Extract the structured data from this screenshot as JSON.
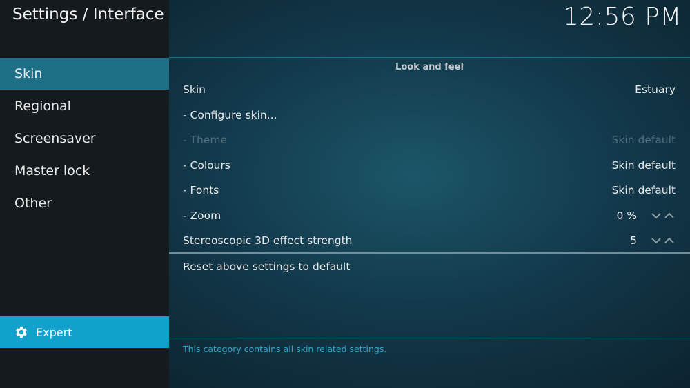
{
  "header": {
    "title": "Settings / Interface",
    "clock": "12:56 PM"
  },
  "sidebar": {
    "items": [
      {
        "label": "Skin",
        "active": true
      },
      {
        "label": "Regional"
      },
      {
        "label": "Screensaver"
      },
      {
        "label": "Master lock"
      },
      {
        "label": "Other"
      }
    ],
    "expert_label": "Expert"
  },
  "main": {
    "section_title": "Look and feel",
    "rows": [
      {
        "label": "Skin",
        "value": "Estuary"
      },
      {
        "label": "- Configure skin...",
        "value": ""
      },
      {
        "label": "- Theme",
        "value": "Skin default",
        "disabled": true
      },
      {
        "label": "- Colours",
        "value": "Skin default"
      },
      {
        "label": "- Fonts",
        "value": "Skin default"
      },
      {
        "label": "- Zoom",
        "value": "0 %"
      },
      {
        "label": "Stereoscopic 3D effect strength",
        "value": "5"
      }
    ],
    "reset_label": "Reset above settings to default",
    "description": "This category contains all skin related settings."
  },
  "colors": {
    "accent": "#12a0cc",
    "active_item": "#1e6f86",
    "sidebar_bg": "#141a1e",
    "description_text": "#3aa6c8"
  },
  "icons": {
    "expert": "gear-icon",
    "spinner_down": "chevron-down-icon",
    "spinner_up": "chevron-up-icon"
  }
}
